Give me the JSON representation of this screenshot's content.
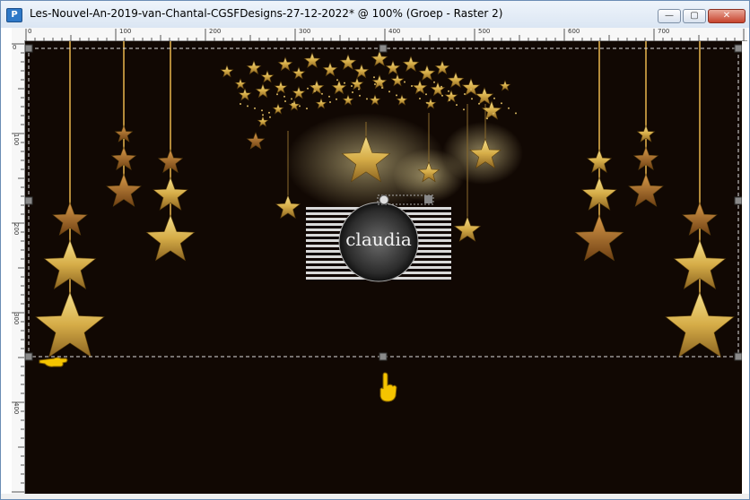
{
  "window": {
    "title": "Les-Nouvel-An-2019-van-Chantal-CGSFDesigns-27-12-2022* @ 100% (Groep - Raster 2)",
    "app_icon": "psp-app-icon",
    "buttons": {
      "minimize": "—",
      "maximize": "▢",
      "close": "✕"
    }
  },
  "ruler": {
    "top_labels": [
      "0",
      "100",
      "200",
      "300",
      "400",
      "500",
      "600",
      "700"
    ],
    "left_labels": [
      "0",
      "100",
      "200",
      "300",
      "400"
    ]
  },
  "canvas": {
    "background": "#110803",
    "watermark_text": "claudia",
    "gold": "#d8b24a"
  },
  "cursors": {
    "pointer_left": "pointing-hand-left-icon",
    "pointer_down": "pointing-hand-up-icon"
  }
}
